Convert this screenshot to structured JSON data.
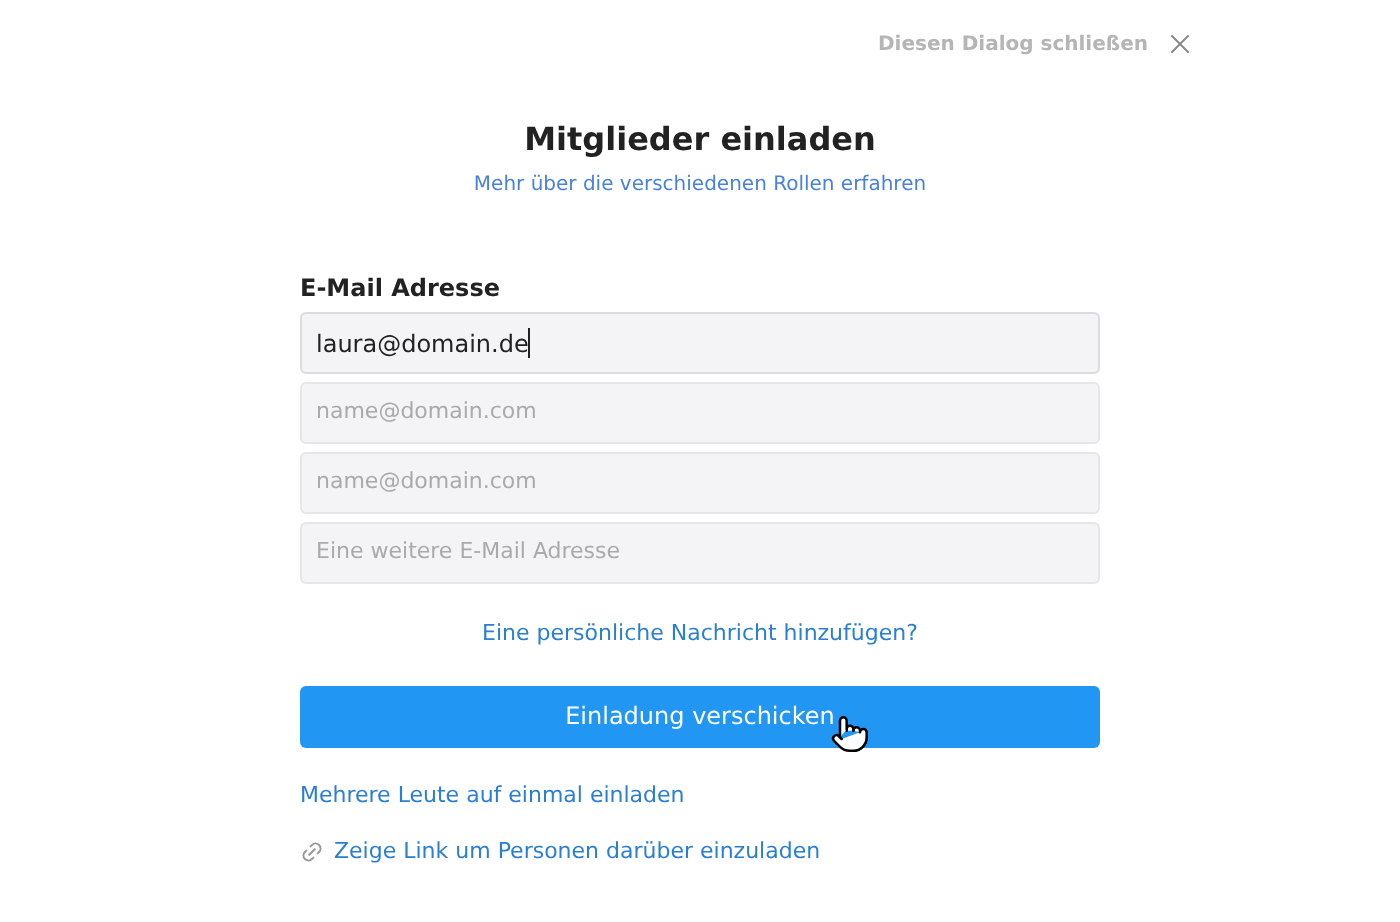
{
  "close": {
    "label": "Diesen Dialog schließen"
  },
  "title": "Mitglieder einladen",
  "roles_link": "Mehr über die verschiedenen Rollen erfahren",
  "email_label": "E-Mail Adresse",
  "fields": [
    {
      "value": "laura@domain.de",
      "focused": true
    },
    {
      "placeholder": "name@domain.com",
      "focused": false
    },
    {
      "placeholder": "name@domain.com",
      "focused": false
    },
    {
      "placeholder": "Eine weitere E-Mail Adresse",
      "focused": false
    }
  ],
  "message_link": "Eine persönliche Nachricht hinzufügen?",
  "submit": "Einladung verschicken",
  "bulk_link": "Mehrere Leute auf einmal einladen",
  "share_link": "Zeige Link um Personen darüber einzuladen"
}
